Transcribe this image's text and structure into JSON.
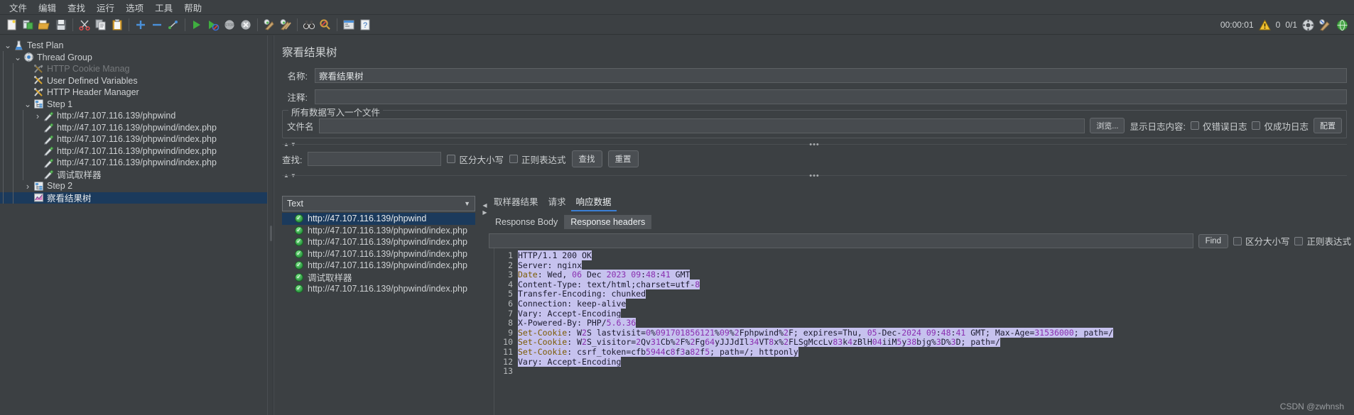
{
  "app": {
    "title": "Apache JMeter",
    "timer": "00:00:01",
    "warn_count": "0",
    "thread_count": "0/1"
  },
  "menubar": {
    "items": [
      {
        "label": "文件",
        "name": "menu-file"
      },
      {
        "label": "编辑",
        "name": "menu-edit"
      },
      {
        "label": "查找",
        "name": "menu-search"
      },
      {
        "label": "运行",
        "name": "menu-run"
      },
      {
        "label": "选项",
        "name": "menu-options"
      },
      {
        "label": "工具",
        "name": "menu-tools"
      },
      {
        "label": "帮助",
        "name": "menu-help"
      }
    ]
  },
  "toolbar": {
    "buttons": [
      {
        "icon": "new-document-icon",
        "name": "new-button"
      },
      {
        "icon": "open-templates-icon",
        "name": "templates-button"
      },
      {
        "icon": "open-folder-icon",
        "name": "open-button"
      },
      {
        "icon": "save-floppy-icon",
        "name": "save-button"
      },
      {
        "icon": "scissors-icon",
        "name": "cut-button"
      },
      {
        "icon": "copy-icon",
        "name": "copy-button"
      },
      {
        "icon": "paste-clipboard-icon",
        "name": "paste-button"
      },
      {
        "icon": "plus-icon",
        "name": "expand-all-button"
      },
      {
        "icon": "minus-icon",
        "name": "collapse-all-button"
      },
      {
        "icon": "toggle-icon",
        "name": "toggle-button"
      },
      {
        "icon": "play-icon",
        "name": "start-button"
      },
      {
        "icon": "play-no-pause-icon",
        "name": "start-no-pauses-button"
      },
      {
        "icon": "stop-icon",
        "name": "stop-button"
      },
      {
        "icon": "shutdown-icon",
        "name": "shutdown-button"
      },
      {
        "icon": "clear-icon",
        "name": "clear-button"
      },
      {
        "icon": "clear-all-icon",
        "name": "clear-all-button"
      },
      {
        "icon": "search-binoculars-icon",
        "name": "search-button"
      },
      {
        "icon": "search-reset-icon",
        "name": "search-reset-button"
      },
      {
        "icon": "function-helper-icon",
        "name": "function-helper-button"
      },
      {
        "icon": "help-icon",
        "name": "help-button"
      }
    ]
  },
  "tree": {
    "nodes": [
      {
        "label": "Test Plan",
        "depth": 0,
        "icon": "test-plan-icon",
        "twisty": "open",
        "state": "normal",
        "name": "tree-node-test-plan"
      },
      {
        "label": "Thread Group",
        "depth": 1,
        "icon": "thread-group-icon",
        "twisty": "open",
        "state": "normal",
        "name": "tree-node-thread-group"
      },
      {
        "label": "HTTP Cookie Manag",
        "depth": 2,
        "icon": "config-element-icon",
        "twisty": "none",
        "state": "disabled",
        "name": "tree-node-http-cookie-manager"
      },
      {
        "label": "User Defined Variables",
        "depth": 2,
        "icon": "config-element-icon",
        "twisty": "none",
        "state": "normal",
        "name": "tree-node-user-defined-variables"
      },
      {
        "label": "HTTP Header Manager",
        "depth": 2,
        "icon": "config-element-icon",
        "twisty": "none",
        "state": "normal",
        "name": "tree-node-http-header-manager"
      },
      {
        "label": "Step 1",
        "depth": 2,
        "icon": "transaction-controller-icon",
        "twisty": "open",
        "state": "normal",
        "name": "tree-node-step-1"
      },
      {
        "label": "http://47.107.116.139/phpwind",
        "depth": 3,
        "icon": "http-sampler-icon",
        "twisty": "closed",
        "state": "normal",
        "name": "tree-node-sampler-1"
      },
      {
        "label": "http://47.107.116.139/phpwind/index.php",
        "depth": 3,
        "icon": "http-sampler-icon",
        "twisty": "none",
        "state": "normal",
        "name": "tree-node-sampler-2"
      },
      {
        "label": "http://47.107.116.139/phpwind/index.php",
        "depth": 3,
        "icon": "http-sampler-icon",
        "twisty": "none",
        "state": "normal",
        "name": "tree-node-sampler-3"
      },
      {
        "label": "http://47.107.116.139/phpwind/index.php",
        "depth": 3,
        "icon": "http-sampler-icon",
        "twisty": "none",
        "state": "normal",
        "name": "tree-node-sampler-4"
      },
      {
        "label": "http://47.107.116.139/phpwind/index.php",
        "depth": 3,
        "icon": "http-sampler-icon",
        "twisty": "none",
        "state": "normal",
        "name": "tree-node-sampler-5"
      },
      {
        "label": "调试取样器",
        "depth": 3,
        "icon": "http-sampler-icon",
        "twisty": "none",
        "state": "normal",
        "name": "tree-node-debug-sampler"
      },
      {
        "label": "Step 2",
        "depth": 2,
        "icon": "transaction-controller-icon",
        "twisty": "closed",
        "state": "normal",
        "name": "tree-node-step-2"
      },
      {
        "label": "察看结果树",
        "depth": 2,
        "icon": "view-results-tree-icon",
        "twisty": "none",
        "state": "selected",
        "name": "tree-node-view-results-tree"
      }
    ]
  },
  "panel": {
    "title": "察看结果树",
    "name_label": "名称:",
    "name_value": "察看结果树",
    "comment_label": "注释:",
    "comment_value": "",
    "group_title": "所有数据写入一个文件",
    "filename_label": "文件名",
    "filename_value": "",
    "browse_button": "浏览...",
    "log_display_label": "显示日志内容:",
    "errors_only_label": "仅错误日志",
    "successes_only_label": "仅成功日志",
    "configure_button": "配置",
    "search_label": "查找:",
    "search_value": "",
    "case_sensitive_label": "区分大小写",
    "regex_label": "正则表达式",
    "find_button": "查找",
    "reset_button": "重置",
    "collapse_dots": "•••"
  },
  "results": {
    "renderer_value": "Text",
    "items": [
      {
        "label": "http://47.107.116.139/phpwind",
        "status": "success",
        "selected": true
      },
      {
        "label": "http://47.107.116.139/phpwind/index.php",
        "status": "success",
        "selected": false
      },
      {
        "label": "http://47.107.116.139/phpwind/index.php",
        "status": "success",
        "selected": false
      },
      {
        "label": "http://47.107.116.139/phpwind/index.php",
        "status": "success",
        "selected": false
      },
      {
        "label": "http://47.107.116.139/phpwind/index.php",
        "status": "success",
        "selected": false
      },
      {
        "label": "调试取样器",
        "status": "success",
        "selected": false
      },
      {
        "label": "http://47.107.116.139/phpwind/index.php",
        "status": "success",
        "selected": false
      }
    ]
  },
  "detail": {
    "tabs": [
      {
        "label": "取样器结果",
        "active": false,
        "name": "tab-sampler-result"
      },
      {
        "label": "请求",
        "active": false,
        "name": "tab-request"
      },
      {
        "label": "响应数据",
        "active": true,
        "name": "tab-response-data"
      }
    ],
    "subtabs": [
      {
        "label": "Response Body",
        "active": false,
        "name": "subtab-response-body"
      },
      {
        "label": "Response headers",
        "active": true,
        "name": "subtab-response-headers"
      }
    ],
    "find_value": "",
    "find_button": "Find",
    "case_sensitive_label": "区分大小写",
    "regex_label": "正则表达式"
  },
  "response_headers": {
    "line_numbers": [
      "1",
      "2",
      "3",
      "4",
      "5",
      "6",
      "7",
      "8",
      "9",
      "10",
      "11",
      "12",
      "13"
    ],
    "lines": [
      "HTTP/1.1 200 OK",
      "Server: nginx",
      "Date: Wed, 06 Dec 2023 09:48:41 GMT",
      "Content-Type: text/html;charset=utf-8",
      "Transfer-Encoding: chunked",
      "Connection: keep-alive",
      "Vary: Accept-Encoding",
      "X-Powered-By: PHP/5.6.36",
      "Set-Cookie: W2S_lastvisit=0%091701856121%09%2Fphpwind%2F; expires=Thu, 05-Dec-2024 09:48:41 GMT; Max-Age=31536000; path=/",
      "Set-Cookie: W2S_visitor=2Qv31Cb%2F%2Fg64yJJJdIl34VT8x%2FLSgMccLv83k4zBlH04iiM5y38bjg%3D%3D; path=/",
      "Set-Cookie: csrf_token=cfb5944c8f3a82f5; path=/; httponly",
      "Vary: Accept-Encoding",
      ""
    ]
  },
  "watermark": "CSDN @zwhnsh"
}
